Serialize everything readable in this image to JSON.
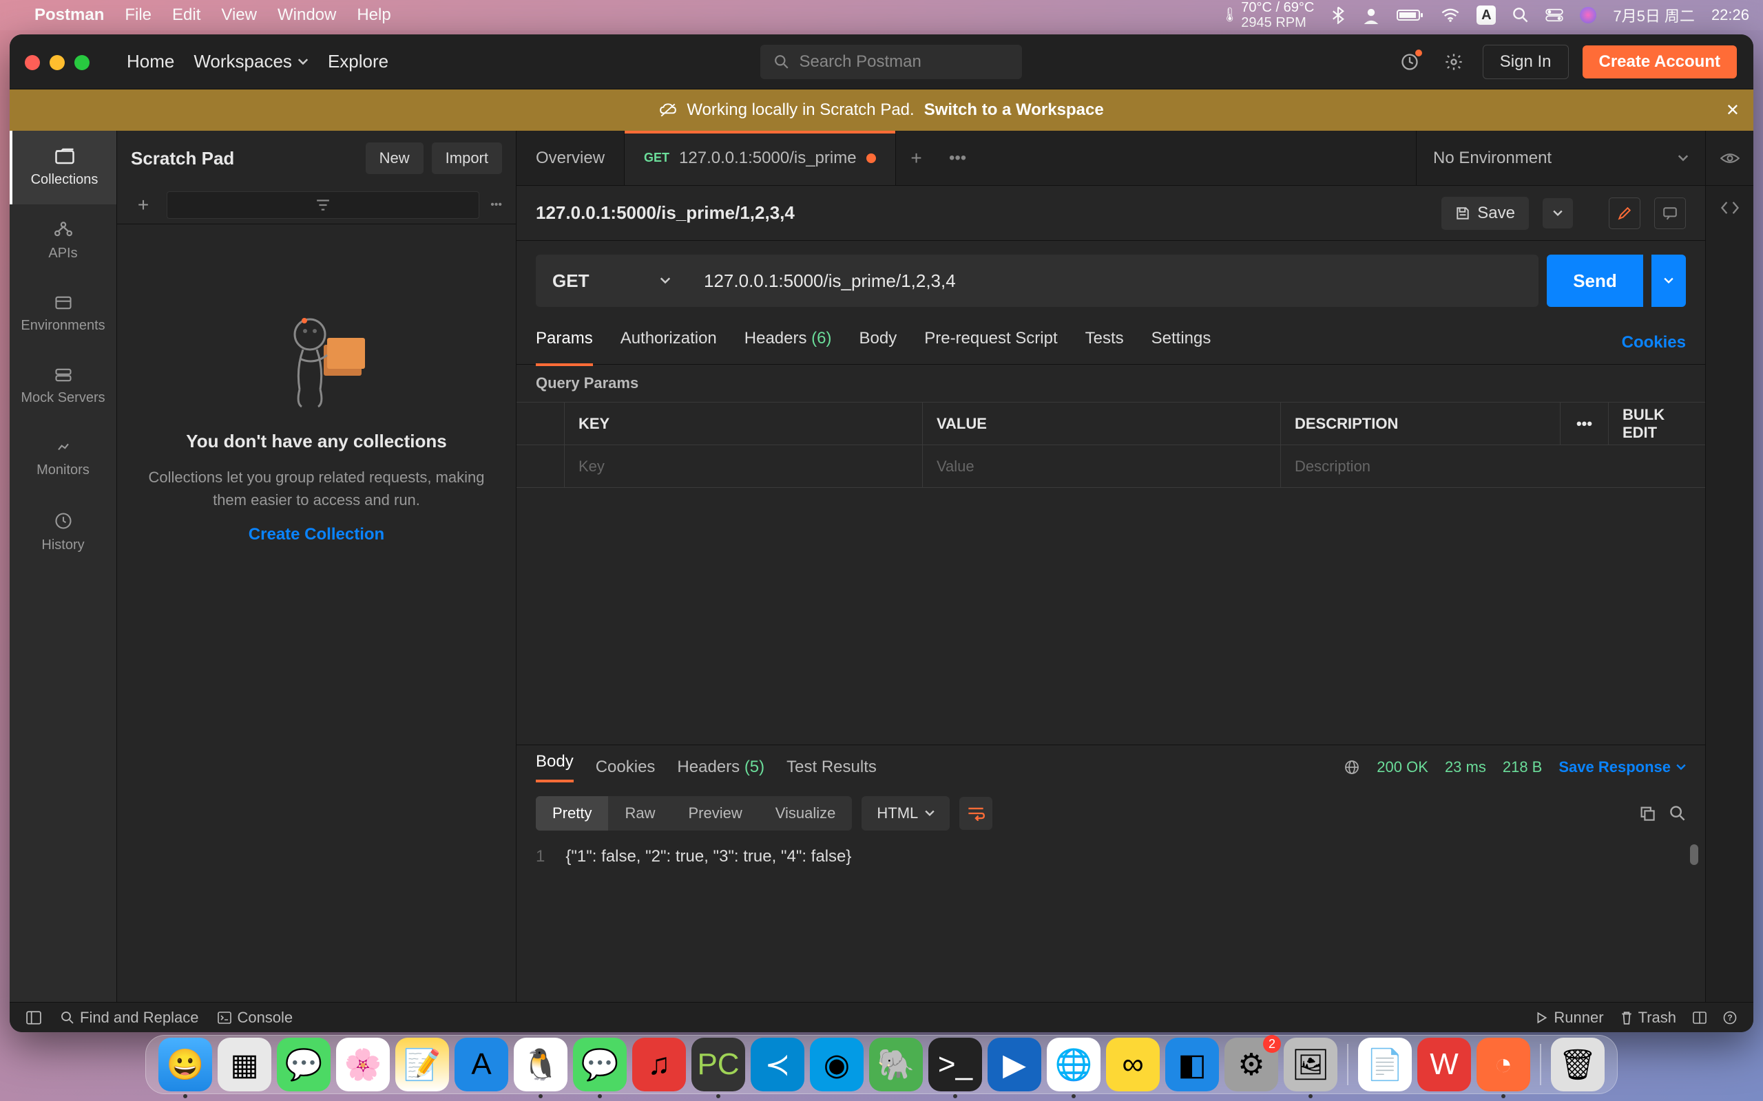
{
  "menubar": {
    "app": "Postman",
    "items": [
      "File",
      "Edit",
      "View",
      "Window",
      "Help"
    ],
    "temp_line1": "70°C / 69°C",
    "temp_line2": "2945 RPM",
    "input_mode": "A",
    "date": "7月5日 周二",
    "time": "22:26"
  },
  "topnav": {
    "home": "Home",
    "workspaces": "Workspaces",
    "explore": "Explore",
    "search_placeholder": "Search Postman",
    "signin": "Sign In",
    "create": "Create Account"
  },
  "banner": {
    "text": "Working locally in Scratch Pad.",
    "switch": "Switch to a Workspace"
  },
  "sidebar_narrow": [
    {
      "icon": "folder",
      "label": "Collections",
      "active": true
    },
    {
      "icon": "api",
      "label": "APIs"
    },
    {
      "icon": "env",
      "label": "Environments"
    },
    {
      "icon": "server",
      "label": "Mock Servers"
    },
    {
      "icon": "monitor",
      "label": "Monitors"
    },
    {
      "icon": "history",
      "label": "History"
    }
  ],
  "sidebar_panel": {
    "title": "Scratch Pad",
    "new_btn": "New",
    "import_btn": "Import",
    "empty_heading": "You don't have any collections",
    "empty_desc": "Collections let you group related requests, making them easier to access and run.",
    "empty_link": "Create Collection"
  },
  "tabs": {
    "overview": "Overview",
    "active_method": "GET",
    "active_title": "127.0.0.1:5000/is_prime"
  },
  "env": {
    "label": "No Environment"
  },
  "request": {
    "breadcrumb": "127.0.0.1:5000/is_prime/1,2,3,4",
    "save": "Save",
    "method": "GET",
    "url": "127.0.0.1:5000/is_prime/1,2,3,4",
    "send": "Send"
  },
  "section_tabs": {
    "params": "Params",
    "authorization": "Authorization",
    "headers": "Headers",
    "headers_count": "(6)",
    "body": "Body",
    "prereq": "Pre-request Script",
    "tests": "Tests",
    "settings": "Settings",
    "cookies": "Cookies"
  },
  "params_table": {
    "label": "Query Params",
    "head_key": "KEY",
    "head_value": "VALUE",
    "head_desc": "DESCRIPTION",
    "bulk": "Bulk Edit",
    "ph_key": "Key",
    "ph_value": "Value",
    "ph_desc": "Description"
  },
  "response_tabs": {
    "body": "Body",
    "cookies": "Cookies",
    "headers": "Headers",
    "headers_count": "(5)",
    "tests": "Test Results",
    "status_code": "200",
    "status_text": "OK",
    "time": "23 ms",
    "size": "218 B",
    "save": "Save Response"
  },
  "response_toolbar": {
    "pretty": "Pretty",
    "raw": "Raw",
    "preview": "Preview",
    "visualize": "Visualize",
    "format": "HTML"
  },
  "response_body": {
    "line_no": "1",
    "content": "{\"1\": false, \"2\": true, \"3\": true, \"4\": false}"
  },
  "statusbar": {
    "find": "Find and Replace",
    "console": "Console",
    "runner": "Runner",
    "trash": "Trash"
  },
  "dock": {
    "badge_settings": "2"
  }
}
